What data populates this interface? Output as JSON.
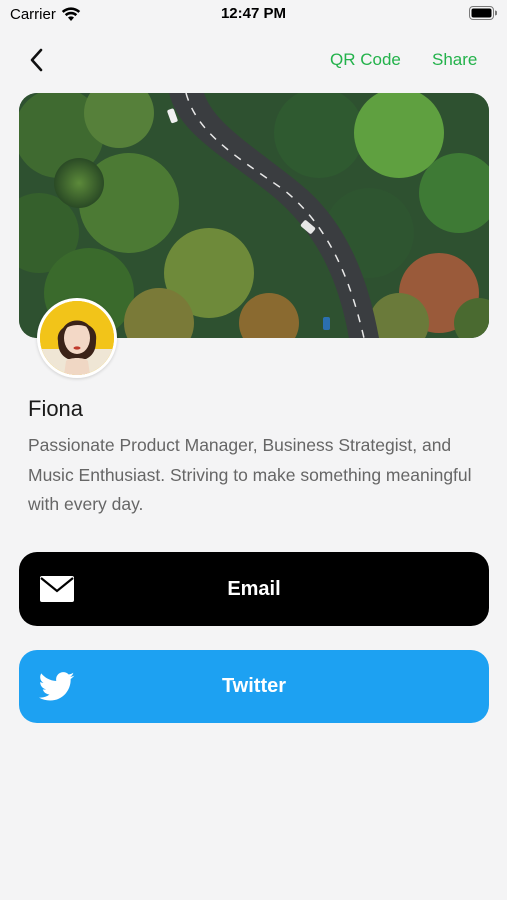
{
  "status_bar": {
    "carrier": "Carrier",
    "time": "12:47 PM"
  },
  "nav": {
    "qr_label": "QR Code",
    "share_label": "Share"
  },
  "profile": {
    "name": "Fiona",
    "bio": "Passionate Product Manager, Business Strategist, and Music Enthusiast. Striving to make something meaningful with every day."
  },
  "actions": {
    "email_label": "Email",
    "twitter_label": "Twitter"
  },
  "icons": {
    "back": "chevron-left-icon",
    "email": "envelope-icon",
    "twitter": "twitter-bird-icon",
    "wifi": "wifi-icon",
    "battery": "battery-icon"
  },
  "colors": {
    "accent_green": "#23b24b",
    "email_button": "#000000",
    "twitter_button": "#1da1f2",
    "background": "#f4f4f5"
  }
}
